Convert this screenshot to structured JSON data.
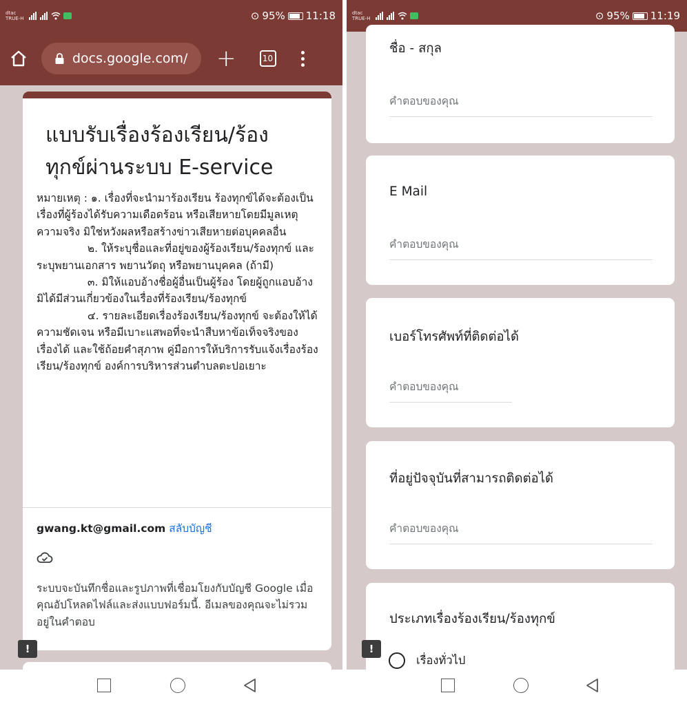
{
  "left_screen": {
    "status": {
      "carrier_line1": "dtac",
      "carrier_line2": "TRUE-H",
      "battery": "95%",
      "time": "11:18"
    },
    "browser": {
      "url": "docs.google.com/",
      "tab_count": "10"
    },
    "form": {
      "title": "แบบรับเรื่องร้องเรียน/ร้องทุกข์ผ่านระบบ E-service",
      "description": "หมายเหตุ : ๑. เรื่องที่จะนำมาร้องเรียน ร้องทุกข์ได้จะต้องเป็นเรื่องที่ผู้ร้องได้รับความเดือดร้อน หรือเสียหายโดยมีมูลเหตุความจริง มิใช่หวังผลหรือสร้างข่าวเสียหายต่อบุคคลอื่น\n               ๒. ให้ระบุชื่อและที่อยู่ของผู้ร้องเรียน/ร้องทุกข์ และระบุพยานเอกสาร พยานวัตถุ หรือพยานบุคคล (ถ้ามี)\n               ๓. มิให้แอบอ้างชื่อผู้อื่นเป็นผู้ร้อง โดยผู้ถูกแอบอ้างมิได้มีส่วนเกี่ยวข้องในเรื่องที่ร้องเรียน/ร้องทุกข์\n               ๔. รายละเอียดเรื่องร้องเรียน/ร้องทุกข์ จะต้องให้ได้ความชัดเจน หรือมีเบาะแสพอที่จะนำสืบหาข้อเท็จจริงของเรื่องได้ และใช้ถ้อยคำสุภาพ คู่มือการให้บริการรับแจ้งเรื่องร้องเรียน/ร้องทุกข์ องค์การบริหารส่วนตำบลตะปอเยาะ",
      "account_email": "gwang.kt@gmail.com",
      "switch_account": "สลับบัญชี",
      "notice": "ระบบจะบันทึกชื่อและรูปภาพที่เชื่อมโยงกับบัญชี Google เมื่อคุณอัปโหลดไฟล์และส่งแบบฟอร์มนี้. อีเมลของคุณจะไม่รวมอยู่ในคำตอบ"
    }
  },
  "right_screen": {
    "status": {
      "carrier_line1": "dtac",
      "carrier_line2": "TRUE-H",
      "battery": "95%",
      "time": "11:19"
    },
    "questions": [
      {
        "title": "ชื่อ - สกุล",
        "placeholder": "คำตอบของคุณ"
      },
      {
        "title": "E Mail",
        "placeholder": "คำตอบของคุณ"
      },
      {
        "title": "เบอร์โทรศัพท์ที่ติดต่อได้",
        "placeholder": "คำตอบของคุณ"
      },
      {
        "title": "ที่อยู่ปัจจุบันที่สามารถติดต่อได้",
        "placeholder": "คำตอบของคุณ"
      },
      {
        "title": "ประเภทเรื่องร้องเรียน/ร้องทุกข์",
        "options": [
          "เรื่องทั่วไป"
        ]
      }
    ]
  },
  "colors": {
    "theme": "#7b3a33",
    "background": "#d6c9c9",
    "link": "#1a73e8"
  },
  "icons": [
    "home-icon",
    "lock-icon",
    "plus-icon",
    "tab-switcher-icon",
    "menu-icon",
    "cloud-icon",
    "report-icon",
    "wifi-icon",
    "nav-recent-icon",
    "nav-home-icon",
    "nav-back-icon"
  ]
}
